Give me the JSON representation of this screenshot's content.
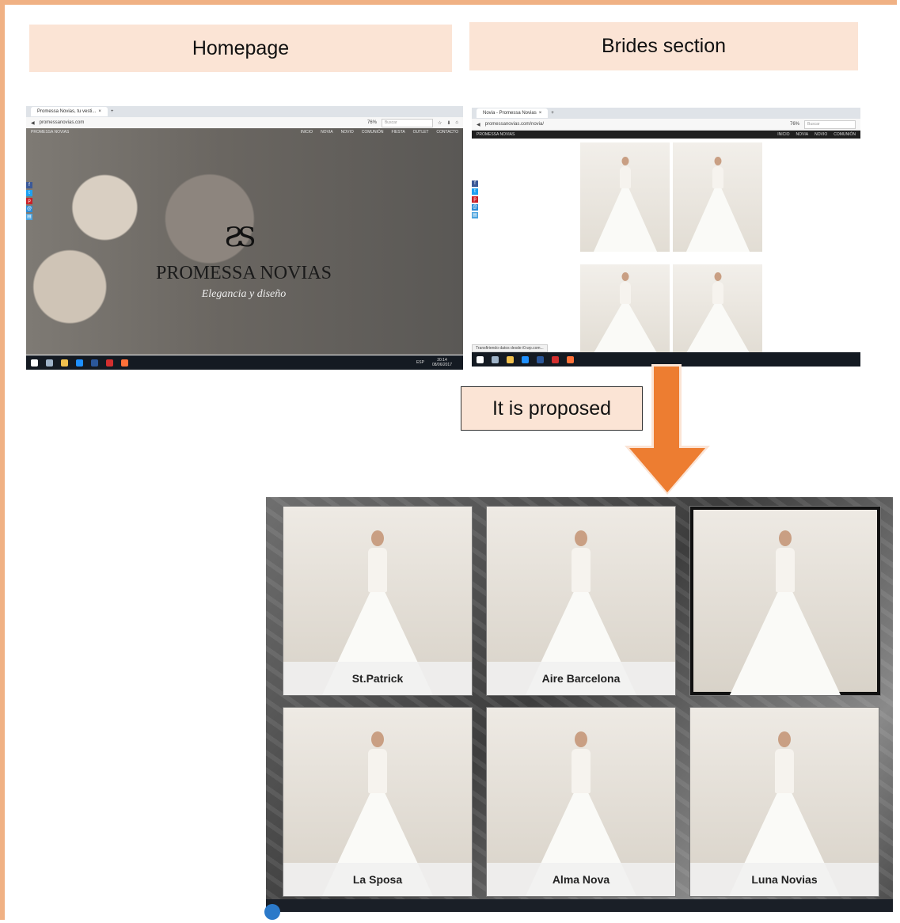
{
  "labels": {
    "homepage": "Homepage",
    "brides": "Brides section",
    "proposed": "It is proposed"
  },
  "home_shot": {
    "tab_title": "Promessa Novias, tu vesti...",
    "url": "promessanovias.com",
    "zoom": "76%",
    "search_placeholder": "Buscar",
    "site_name": "PROMESSA NOVIAS",
    "nav": [
      "INICIO",
      "NOVIA",
      "NOVIO",
      "COMUNIÓN",
      "FIESTA",
      "OUTLET",
      "CONTACTO"
    ],
    "logo_mark": "ƧS",
    "brand": "PROMESSA NOVIAS",
    "tagline": "Elegancia y diseño",
    "clock_time": "20:14",
    "clock_date": "08/06/2017",
    "lang": "ESP"
  },
  "brides_shot": {
    "tab_title": "Novia - Promessa Novias",
    "url": "promessanovias.com/novia/",
    "zoom": "76%",
    "search_placeholder": "Buscar",
    "site_name": "PROMESSA NOVIAS",
    "nav": [
      "INICIO",
      "NOVIA",
      "NOVIO",
      "COMUNIÓN"
    ],
    "status": "Transfiriendo datos desde i0.wp.com..."
  },
  "proposal": {
    "cards": [
      {
        "name": "St.Patrick"
      },
      {
        "name": "Aire Barcelona"
      },
      {
        "name": ""
      },
      {
        "name": "La Sposa"
      },
      {
        "name": "Alma Nova"
      },
      {
        "name": "Luna Novias"
      }
    ]
  },
  "colors": {
    "border": "#f0b184",
    "label_bg": "#fbe4d5",
    "arrow": "#ed7d31"
  }
}
